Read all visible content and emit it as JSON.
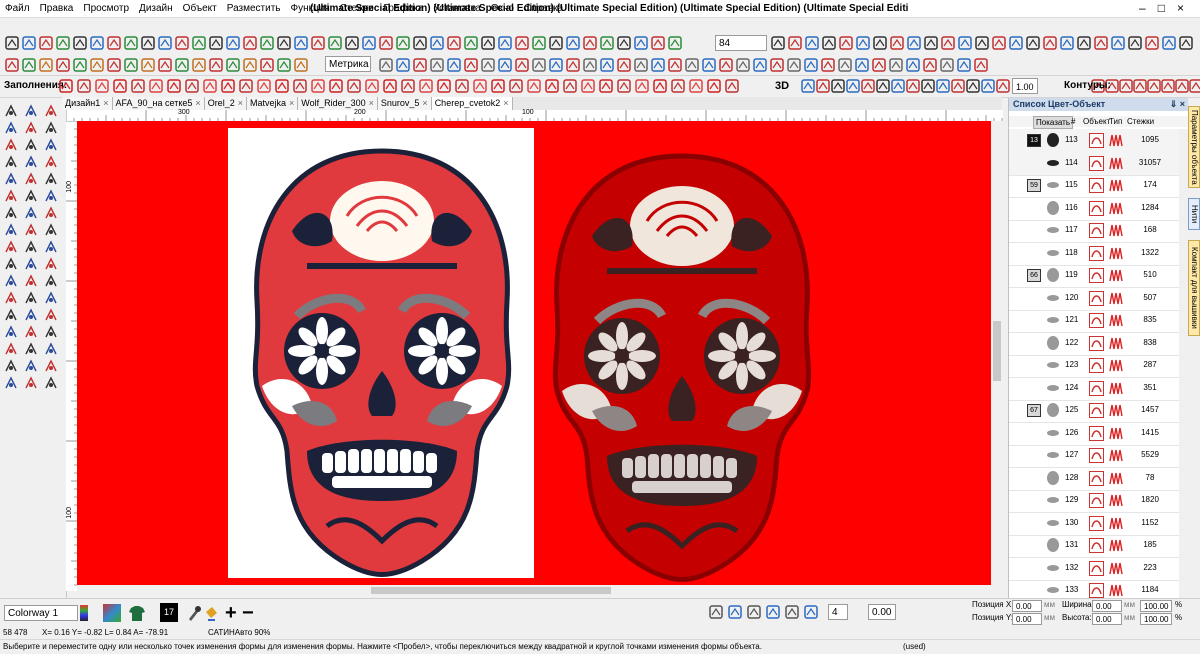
{
  "window": {
    "title": "(Ultimate Special Edition) (Ultimate Special Edition) (Ultimate Special Edition) (Ultimate Special Edition) (Ultimate Special Editi",
    "controls": [
      "–",
      "□",
      "×"
    ]
  },
  "menu": [
    "Файл",
    "Правка",
    "Просмотр",
    "Дизайн",
    "Объект",
    "Разместить",
    "Функция",
    "Стежки",
    "Графика",
    "Установка",
    "Окно",
    "Справка"
  ],
  "toolbar": {
    "zoom_value": "84",
    "units_value": "Метрика",
    "fills_label": "Заполнения:",
    "contours_label": "Контуры:",
    "line_width": "1.00",
    "threed_label": "3D"
  },
  "tabs": [
    "Дизайн1",
    "AFA_90_на сетке5",
    "Orel_2",
    "Matvejka",
    "Wolf_Rider_300",
    "Snurov_5",
    "Cherep_cvetok2"
  ],
  "rulers": {
    "h_ticks": [
      "300",
      "200",
      "100"
    ],
    "v_ticks": [
      "100",
      "100"
    ]
  },
  "panel": {
    "title": "Список Цвет-Объект",
    "pin": "⇓ ×",
    "show_btn": "Показать",
    "col_num": "#",
    "col_obj": "Объект",
    "col_type": "Тип",
    "col_stitches": "Стежки",
    "rows": [
      {
        "group": "13",
        "num": "113",
        "stitches": "1095"
      },
      {
        "group": "",
        "num": "114",
        "stitches": "31057"
      },
      {
        "group": "59",
        "num": "115",
        "stitches": "174"
      },
      {
        "group": "",
        "num": "116",
        "stitches": "1284"
      },
      {
        "group": "",
        "num": "117",
        "stitches": "168"
      },
      {
        "group": "",
        "num": "118",
        "stitches": "1322"
      },
      {
        "group": "66",
        "num": "119",
        "stitches": "510"
      },
      {
        "group": "",
        "num": "120",
        "stitches": "507"
      },
      {
        "group": "",
        "num": "121",
        "stitches": "835"
      },
      {
        "group": "",
        "num": "122",
        "stitches": "838"
      },
      {
        "group": "",
        "num": "123",
        "stitches": "287"
      },
      {
        "group": "",
        "num": "124",
        "stitches": "351"
      },
      {
        "group": "67",
        "num": "125",
        "stitches": "1457"
      },
      {
        "group": "",
        "num": "126",
        "stitches": "1415"
      },
      {
        "group": "",
        "num": "127",
        "stitches": "5529"
      },
      {
        "group": "",
        "num": "128",
        "stitches": "78"
      },
      {
        "group": "",
        "num": "129",
        "stitches": "1820"
      },
      {
        "group": "",
        "num": "130",
        "stitches": "1152"
      },
      {
        "group": "",
        "num": "131",
        "stitches": "185"
      },
      {
        "group": "",
        "num": "132",
        "stitches": "223"
      },
      {
        "group": "",
        "num": "133",
        "stitches": "1184"
      }
    ]
  },
  "side_tabs": [
    "Параметры объекта",
    "Нити",
    "Компакт для вышивки"
  ],
  "bottom": {
    "colorway": "Colorway 1",
    "thread_num": "17",
    "width_value": "4",
    "angle_value": "0.00",
    "pos_x_label": "Позиция X:",
    "pos_y_label": "Позиция Y:",
    "pos_x": "0.00",
    "pos_y": "0.00",
    "width_label": "Ширина:",
    "height_label": "Высота:",
    "width": "0.00",
    "height": "0.00",
    "unit": "мм",
    "pct_w": "100.00",
    "pct_h": "100.00",
    "pct": "%"
  },
  "status": {
    "stitch_count": "58 478",
    "coords": "X= 0.16 Y= -0.82 L= 0.84 A= -78.91",
    "mode": "САТИНАвто 90%",
    "hint": "Выберите и переместите одну или несколько точек изменения формы для изменения формы. Нажмите <Пробел>, чтобы переключиться между квадратной и круглой точками изменения формы объекта.",
    "used": "(used)"
  },
  "colors": {
    "canvas": "#ff0000",
    "skull_red": "#e03a3e",
    "skull_dark": "#1a2138",
    "embroidery_red": "#c40000",
    "panel_header": "#cfdcec"
  }
}
